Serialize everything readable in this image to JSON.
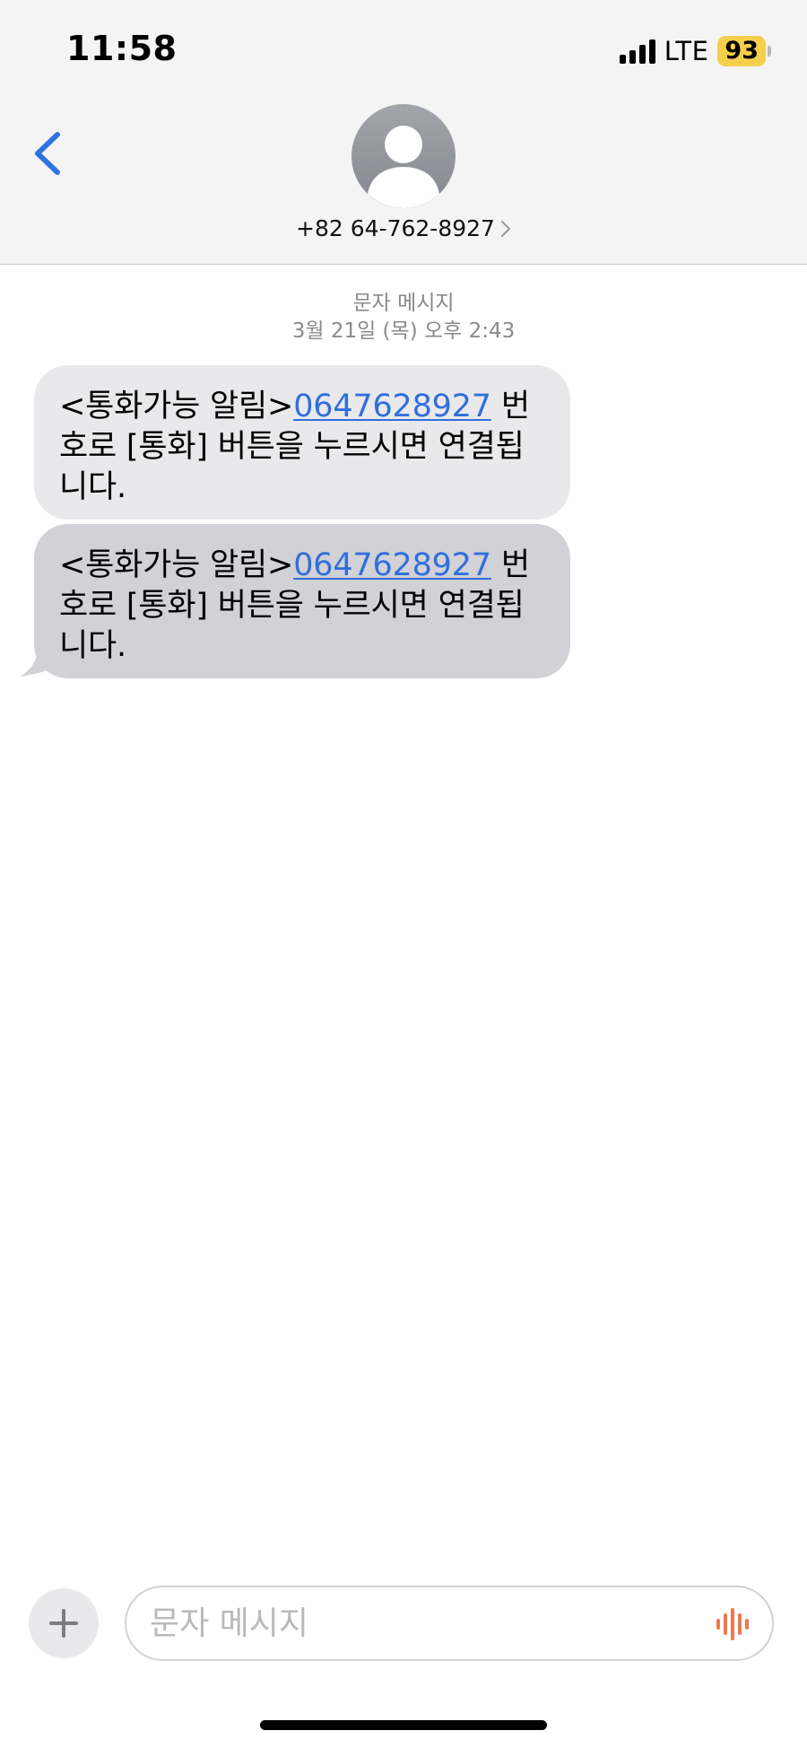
{
  "status_bar": {
    "time": "11:58",
    "network": "LTE",
    "battery_level": "93",
    "battery_color": "#f3cf4c"
  },
  "header": {
    "back_icon": "chevron-left-icon",
    "avatar_icon": "person-silhouette-icon",
    "contact": "+82 64-762-8927",
    "contact_chevron_icon": "chevron-right-icon"
  },
  "conversation": {
    "service_label": "문자 메시지",
    "timestamp": "3월 21일 (목) 오후 2:43",
    "messages": [
      {
        "prefix": "<통화가능 알림>",
        "link": "0647628927",
        "body": "번호로 [통화] 버튼을 누르시면 연결됩니다.",
        "bubble_color": "#e9e9eb"
      },
      {
        "prefix": "<통화가능 알림>",
        "link": "0647628927",
        "body": "번호로 [통화] 버튼을 누르시면 연결됩니다.",
        "bubble_color": "#d1d1d6"
      }
    ],
    "link_color": "#2f6fdd"
  },
  "composer": {
    "add_icon": "plus-icon",
    "placeholder": "문자 메시지",
    "voice_icon": "waveform-icon",
    "voice_color": "#f0784f"
  }
}
